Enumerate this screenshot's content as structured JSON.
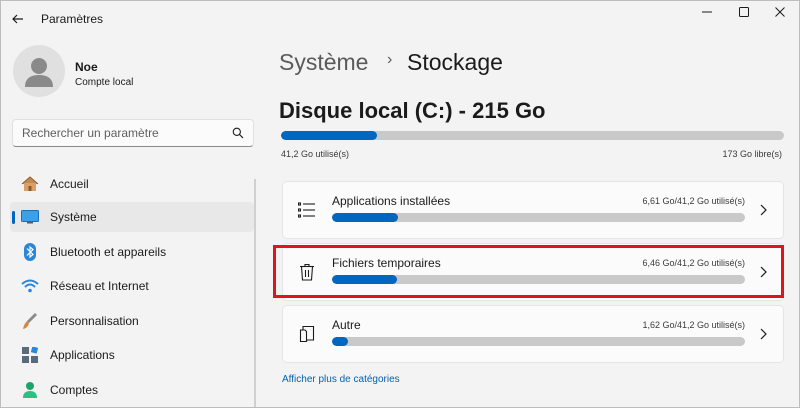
{
  "window": {
    "title": "Paramètres",
    "controls": [
      "minimize",
      "maximize",
      "close"
    ]
  },
  "profile": {
    "name": "Noe",
    "account_type": "Compte local"
  },
  "search": {
    "placeholder": "Rechercher un paramètre",
    "value": ""
  },
  "sidebar": {
    "items": [
      {
        "label": "Accueil",
        "icon": "home-icon",
        "active": false
      },
      {
        "label": "Système",
        "icon": "monitor-icon",
        "active": true
      },
      {
        "label": "Bluetooth et appareils",
        "icon": "bluetooth-icon",
        "active": false
      },
      {
        "label": "Réseau et Internet",
        "icon": "wifi-icon",
        "active": false
      },
      {
        "label": "Personnalisation",
        "icon": "brush-icon",
        "active": false
      },
      {
        "label": "Applications",
        "icon": "apps-icon",
        "active": false
      },
      {
        "label": "Comptes",
        "icon": "person-icon",
        "active": false
      }
    ]
  },
  "breadcrumb": {
    "parent": "Système",
    "separator": "›",
    "current": "Stockage"
  },
  "disk": {
    "title": "Disque local (C:) - 215 Go",
    "used": "41,2 Go utilisé(s)",
    "free": "173 Go libre(s)",
    "used_fraction": 0.19
  },
  "categories": [
    {
      "title": "Applications installées",
      "size": "6,61 Go/41,2 Go utilisé(s)",
      "fraction": 0.16,
      "icon": "list-icon",
      "highlighted": false
    },
    {
      "title": "Fichiers temporaires",
      "size": "6,46 Go/41,2 Go utilisé(s)",
      "fraction": 0.157,
      "icon": "trash-icon",
      "highlighted": true
    },
    {
      "title": "Autre",
      "size": "1,62 Go/41,2 Go utilisé(s)",
      "fraction": 0.039,
      "icon": "folder-document-icon",
      "highlighted": false
    }
  ],
  "more_link": "Afficher plus de catégories",
  "colors": {
    "accent": "#0067c0",
    "bar_track": "#c9c9c9",
    "highlight": "#e0141b",
    "link": "#0062b3"
  }
}
